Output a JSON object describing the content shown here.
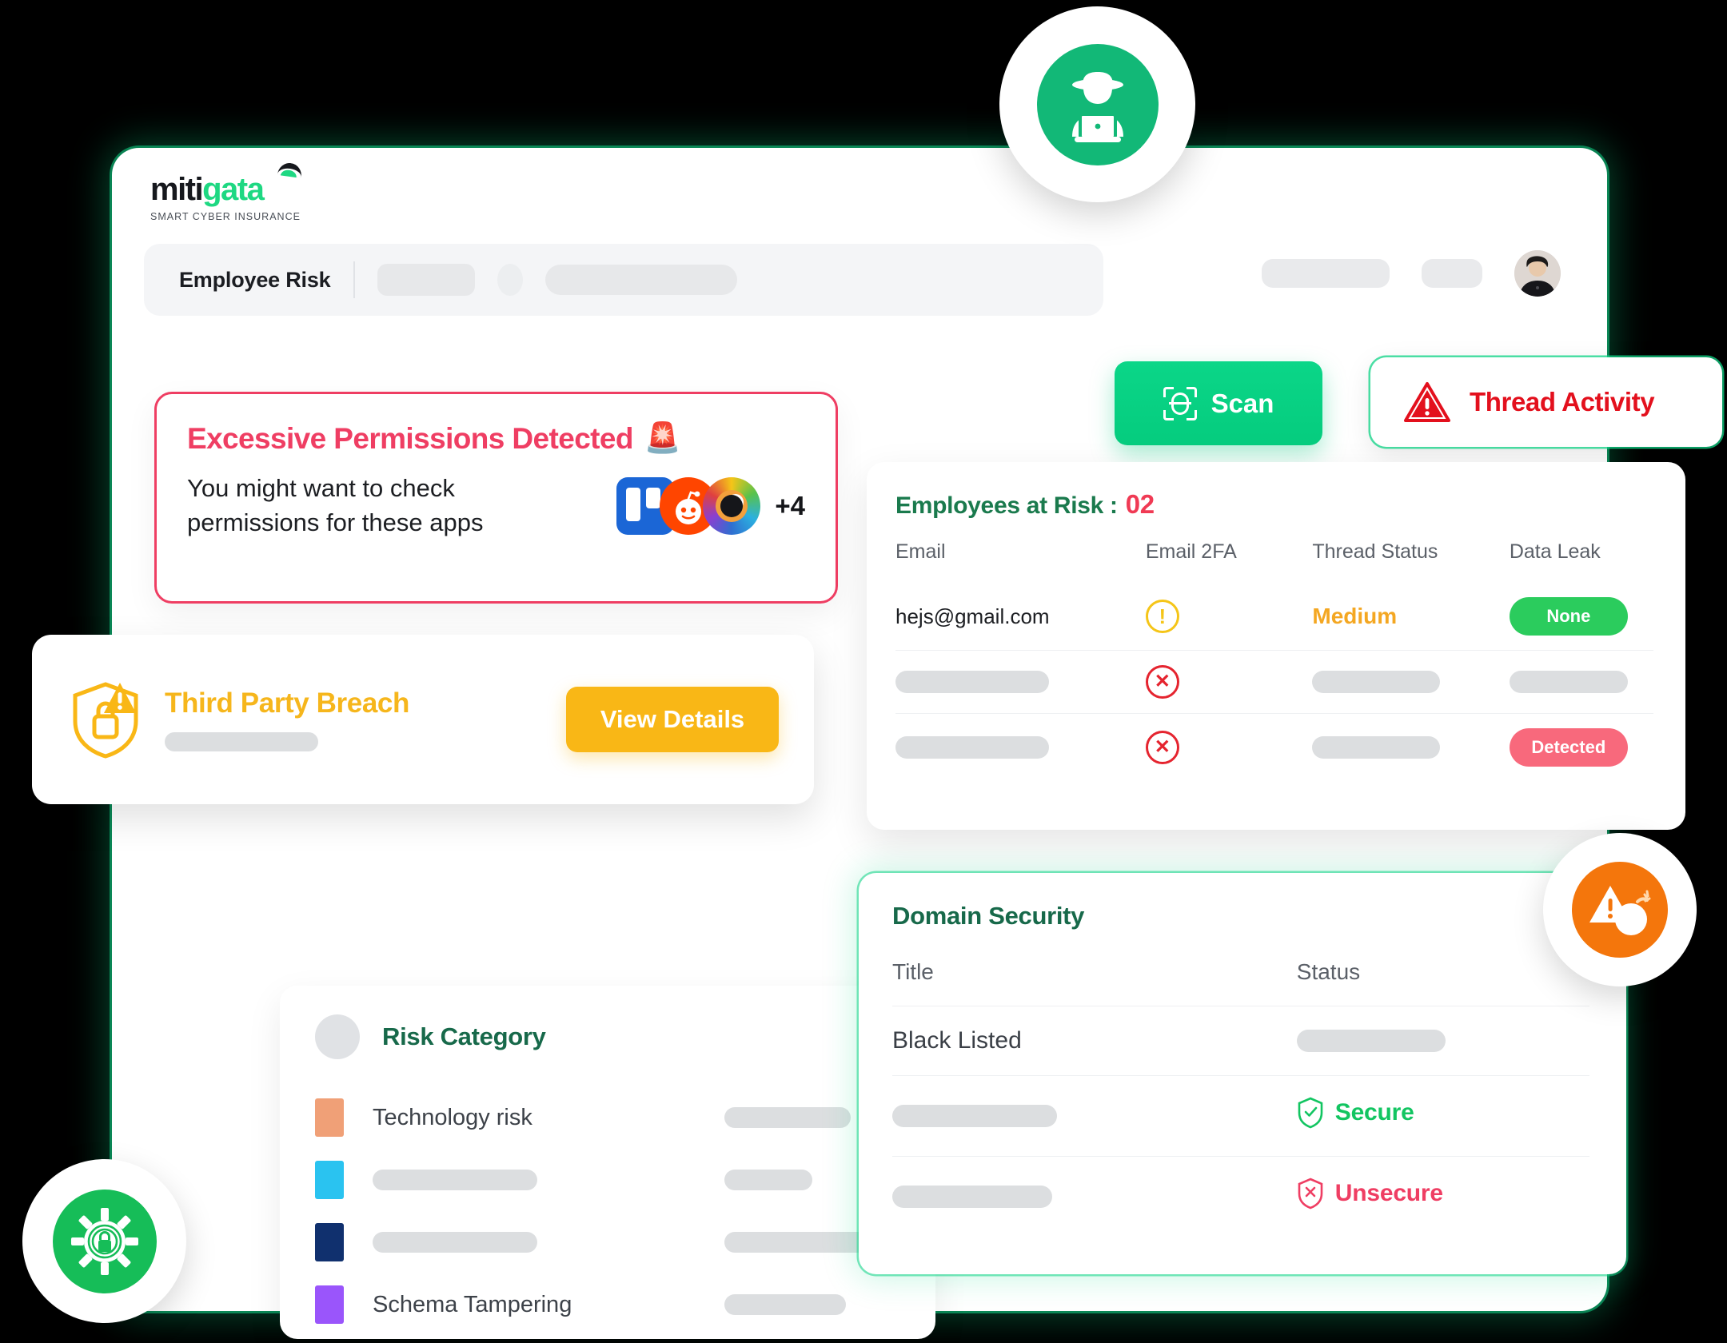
{
  "brand": {
    "name_part1": "miti",
    "name_part2": "gata",
    "tagline": "SMART CYBER INSURANCE",
    "accent_green": "#1ed882",
    "accent_dark": "#16181d"
  },
  "topbar": {
    "title": "Employee Risk"
  },
  "permissions_alert": {
    "title": "Excessive Permissions Detected",
    "title_emoji": "🚨",
    "body": "You might want to check permissions for these apps",
    "apps": [
      "trello-icon",
      "reddit-icon",
      "rainbow-eye-icon"
    ],
    "more_count": "+4",
    "border_color": "#ef3e63"
  },
  "scan_button": {
    "label": "Scan",
    "icon": "scan-icon",
    "color": "#0bd688"
  },
  "thread_activity": {
    "label": "Thread Activity",
    "icon": "warning-triangle-icon",
    "color": "#e3101d"
  },
  "employees_at_risk": {
    "title": "Employees at Risk :",
    "count": "02",
    "title_color": "#1a7a4d",
    "count_color": "#f03a54",
    "columns": [
      "Email",
      "Email 2FA",
      "Thread Status",
      "Data Leak"
    ],
    "rows": [
      {
        "email": "hejs@gmail.com",
        "twofa": "warning-circle-icon",
        "thread_status": "Medium",
        "data_leak": "None",
        "data_leak_style": "none"
      },
      {
        "email": "",
        "twofa": "x-circle-icon",
        "thread_status": "",
        "data_leak": "",
        "data_leak_style": "placeholder"
      },
      {
        "email": "",
        "twofa": "x-circle-icon",
        "thread_status": "",
        "data_leak": "Detected",
        "data_leak_style": "detected"
      }
    ]
  },
  "third_party_breach": {
    "title": "Third Party Breach",
    "icon": "shield-lock-warning-icon",
    "button_label": "View Details",
    "color": "#f9b716"
  },
  "risk_category": {
    "title": "Risk Category",
    "title_color": "#17694a",
    "items": [
      {
        "color": "#f0a077",
        "label": "Technology risk",
        "value": ""
      },
      {
        "color": "#2ac3f0",
        "label": "",
        "value": ""
      },
      {
        "color": "#10306e",
        "label": "",
        "value": ""
      },
      {
        "color": "#9a55fb",
        "label": "Schema Tampering",
        "value": ""
      }
    ]
  },
  "domain_security": {
    "title": "Domain Security",
    "title_color": "#17694a",
    "columns": [
      "Title",
      "Status"
    ],
    "rows": [
      {
        "title": "Black Listed",
        "status": "",
        "status_style": "placeholder"
      },
      {
        "title": "",
        "status": "Secure",
        "status_style": "secure"
      },
      {
        "title": "",
        "status": "Unsecure",
        "status_style": "unsecure"
      }
    ]
  },
  "floating_badges": [
    {
      "icon": "hacker-icon",
      "color": "#12b877"
    },
    {
      "icon": "bomb-warning-icon",
      "color": "#f4760c"
    },
    {
      "icon": "gear-lock-icon",
      "color": "#16bd58"
    }
  ]
}
